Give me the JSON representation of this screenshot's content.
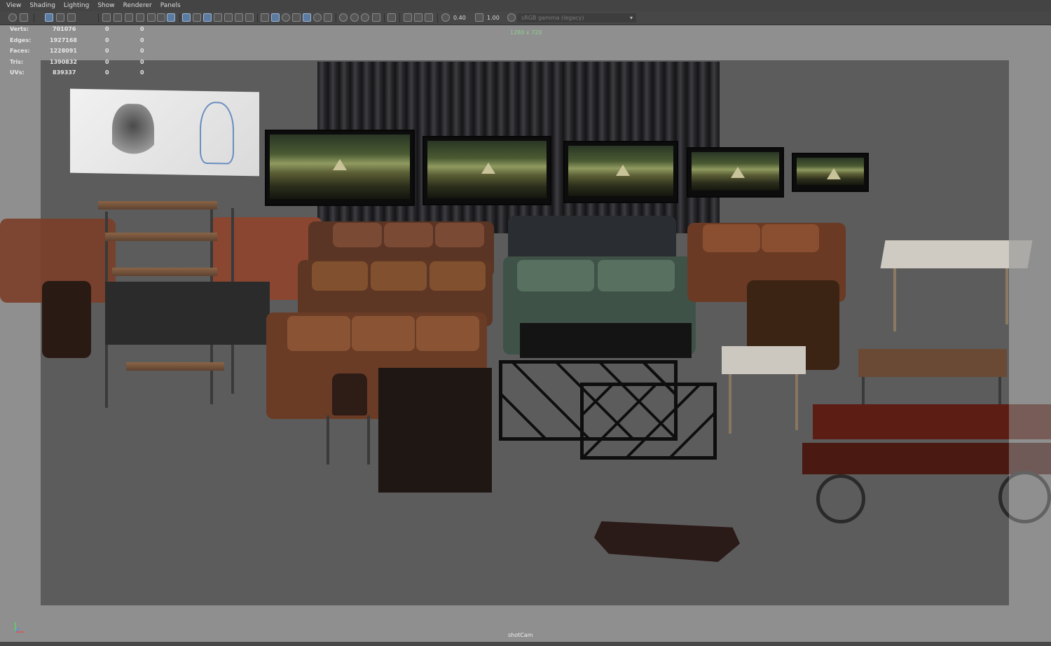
{
  "menu": [
    "View",
    "Shading",
    "Lighting",
    "Show",
    "Renderer",
    "Panels"
  ],
  "toolbar": {
    "exposure": "0.40",
    "gamma": "1.00",
    "colorspace": "sRGB gamma (legacy)",
    "icons": [
      "camera-select-icon",
      "camera-attributes-icon",
      "bookmark-icon",
      "image-plane-icon",
      "grid-icon",
      "film-gate-icon",
      "resolution-gate-icon",
      "gate-mask-icon",
      "field-chart-icon",
      "safe-action-icon",
      "safe-title-icon",
      "wireframe-icon",
      "smooth-shade-icon",
      "default-material-icon",
      "xray-icon",
      "textured-icon",
      "use-lights-icon",
      "shadows-icon",
      "ambient-occlusion-icon",
      "motion-blur-icon",
      "anti-alias-icon",
      "isolate-select-icon",
      "xray-joints-icon",
      "xray-active-icon",
      "exposure-icon",
      "gamma-icon",
      "color-management-icon"
    ]
  },
  "hud": {
    "stats": [
      {
        "label": "Verts:",
        "values": [
          "701076",
          "0",
          "0"
        ]
      },
      {
        "label": "Edges:",
        "values": [
          "1927168",
          "0",
          "0"
        ]
      },
      {
        "label": "Faces:",
        "values": [
          "1228091",
          "0",
          "0"
        ]
      },
      {
        "label": "Tris:",
        "values": [
          "1390832",
          "0",
          "0"
        ]
      },
      {
        "label": "UVs:",
        "values": [
          "839337",
          "0",
          "0"
        ]
      }
    ],
    "resolution": "1280 x 720",
    "camera": "shotCam"
  },
  "colors": {
    "menubar": "#444444",
    "toolbar": "#474747",
    "viewport_outer": "#8f8f8f",
    "viewport_scene": "#5c5c5c",
    "resolution_text": "#8fd08f",
    "toggle_active": "#5b7ba0"
  }
}
